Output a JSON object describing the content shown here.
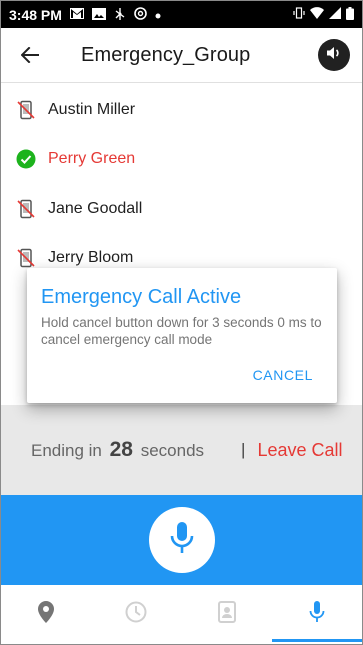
{
  "status_bar": {
    "time": "3:48 PM",
    "icons": [
      "gmail-icon",
      "photo-icon",
      "usb-icon",
      "at-icon",
      "dot-icon"
    ],
    "right_icons": [
      "vibrate-icon",
      "wifi-icon",
      "signal-icon",
      "battery-icon"
    ]
  },
  "app_bar": {
    "title": "Emergency_Group",
    "back_icon": "arrow-back-icon",
    "speaker_icon": "speaker-icon"
  },
  "members": [
    {
      "name": "Austin Miller",
      "status": "unavailable",
      "icon": "phone-off-icon"
    },
    {
      "name": "Perry Green",
      "status": "active",
      "icon": "check-circle-icon"
    },
    {
      "name": "Jane Goodall",
      "status": "unavailable",
      "icon": "phone-off-icon"
    },
    {
      "name": "Jerry Bloom",
      "status": "unavailable",
      "icon": "phone-off-icon"
    }
  ],
  "dialog": {
    "title": "Emergency Call Active",
    "message": "Hold cancel button down for 3 seconds 0 ms to cancel emergency call mode",
    "cancel_label": "CANCEL"
  },
  "call_bar": {
    "ending_prefix": "Ending in",
    "seconds_value": "28",
    "ending_suffix": "seconds",
    "separator": "|",
    "leave_label": "Leave Call"
  },
  "ptt": {
    "icon": "microphone-icon"
  },
  "bottom_nav": {
    "tabs": [
      {
        "name": "location",
        "icon": "location-pin-icon",
        "selected": false
      },
      {
        "name": "history",
        "icon": "clock-icon",
        "selected": false
      },
      {
        "name": "contacts",
        "icon": "contacts-icon",
        "selected": false
      },
      {
        "name": "talk",
        "icon": "microphone-icon",
        "selected": true
      }
    ]
  },
  "colors": {
    "accent": "#2196f3",
    "danger": "#e53935",
    "success": "#1db31d",
    "dim_gray": "#e8e8e8"
  }
}
